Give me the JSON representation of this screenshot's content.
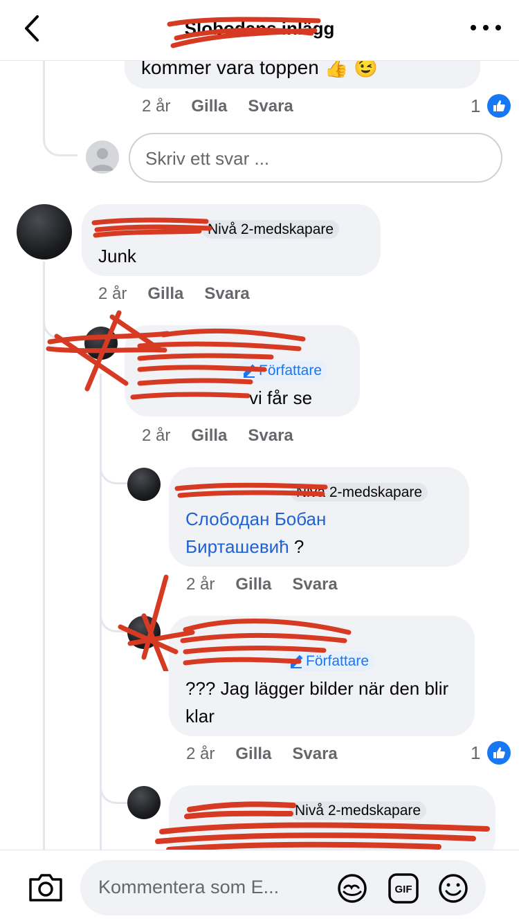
{
  "header": {
    "title": "Slobodans inlägg"
  },
  "comments": [
    {
      "text": "kommer vara toppen 👍 😉",
      "age": "2 år",
      "like": "Gilla",
      "reply": "Svara",
      "likes": "1"
    },
    {
      "role": "Nivå 2-medskapare",
      "text": "Junk",
      "age": "2 år",
      "like": "Gilla",
      "reply": "Svara"
    },
    {
      "role": "Författare",
      "text": "vi får se",
      "age": "2 år",
      "like": "Gilla",
      "reply": "Svara"
    },
    {
      "role": "Nivå 2-medskapare",
      "mention_line1": "Слободан Бобан",
      "mention_line2": "Бирташевић",
      "text_suffix": " ?",
      "age": "2 år",
      "like": "Gilla",
      "reply": "Svara"
    },
    {
      "role": "Författare",
      "text": "??? Jag lägger bilder när den blir klar",
      "age": "2 år",
      "like": "Gilla",
      "reply": "Svara",
      "likes": "1"
    },
    {
      "role": "Nivå 2-medskapare"
    }
  ],
  "reply_input": {
    "placeholder": "Skriv ett svar ..."
  },
  "composer": {
    "placeholder": "Kommentera som E..."
  },
  "icons": [
    "back-chevron-icon",
    "more-icon",
    "like-icon",
    "camera-icon",
    "avatar-sticker-icon",
    "gif-icon",
    "emoji-icon"
  ],
  "colors": {
    "accent": "#1877f2",
    "mention": "#1e62d6",
    "bubble": "#f0f2f5",
    "redaction": "#d63a22"
  }
}
